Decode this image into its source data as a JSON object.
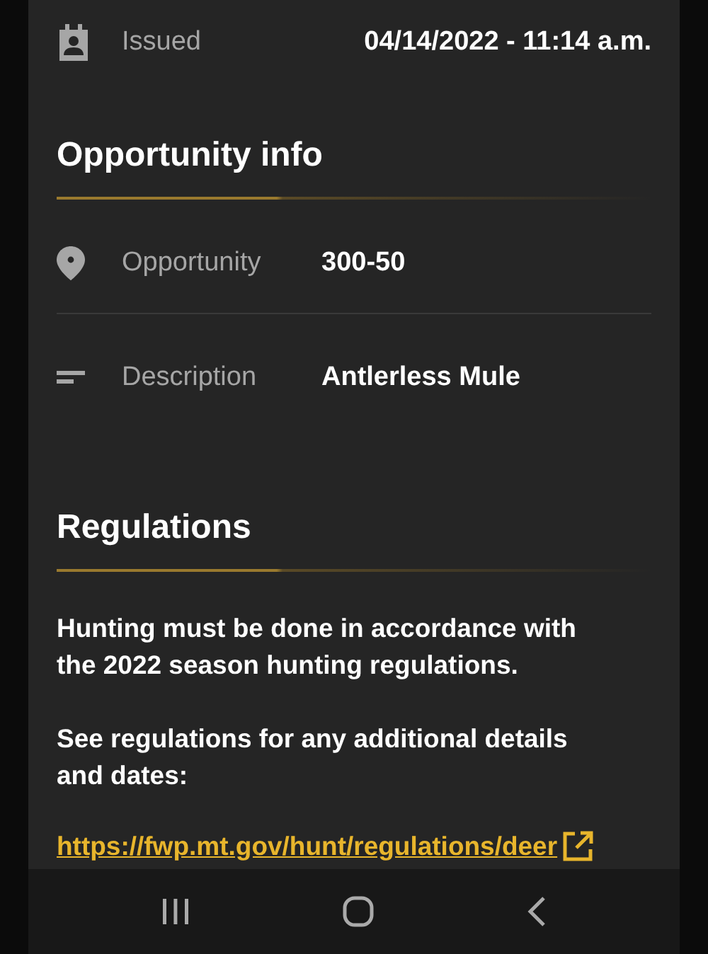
{
  "issued": {
    "label": "Issued",
    "value": "04/14/2022 - 11:14 a.m.",
    "kind": "right"
  },
  "opportunity_info": {
    "title": "Opportunity info",
    "rows": [
      {
        "label": "Opportunity",
        "value": "300-50",
        "kind": "inline"
      },
      {
        "label": "Description",
        "value": "Antlerless Mule",
        "kind": "inline"
      }
    ]
  },
  "regulations": {
    "title": "Regulations",
    "paragraphs": [
      "Hunting must be done in accordance with the 2022 season hunting regulations.",
      "See regulations for any additional details and dates:"
    ],
    "link": "https://fwp.mt.gov/hunt/regulations/deer"
  },
  "nav_bar": {
    "buttons": [
      {
        "kind": "recents"
      },
      {
        "kind": "home"
      },
      {
        "kind": "back"
      }
    ]
  }
}
